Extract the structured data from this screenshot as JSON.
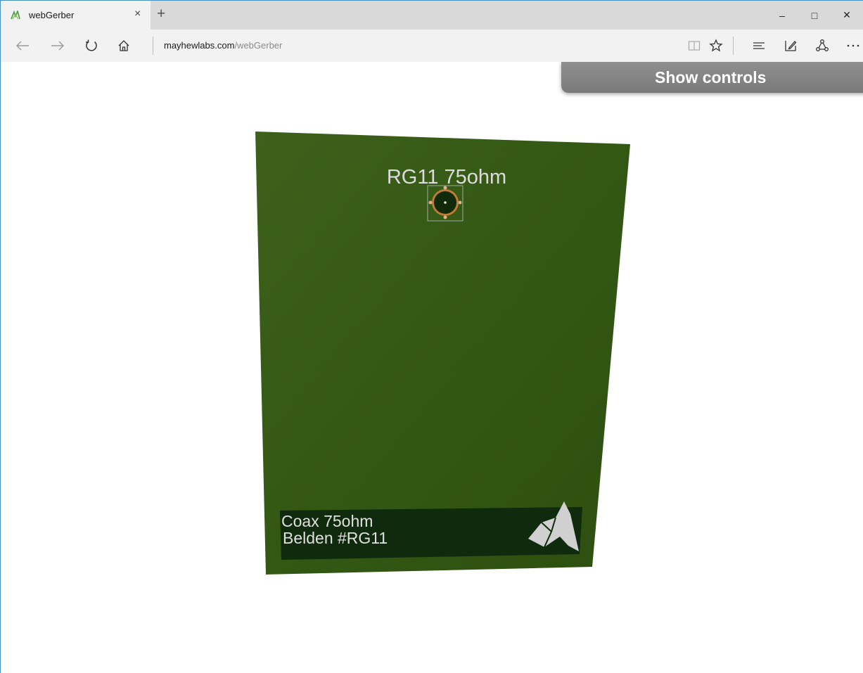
{
  "tab": {
    "title": "webGerber",
    "close_icon": "×",
    "new_tab_icon": "+"
  },
  "window_controls": {
    "minimize": "–",
    "maximize": "□",
    "close": "✕"
  },
  "address": {
    "host": "mayhewlabs.com",
    "path": "/webGerber"
  },
  "page": {
    "show_controls_label": "Show controls",
    "board": {
      "top_label": "RG11 75ohm",
      "bottom_label_line1": "Coax 75ohm",
      "bottom_label_line2": "Belden #RG11",
      "colors": {
        "soldermask": "#355c15",
        "silkscreen": "#d9d9d9",
        "label_box": "#0f2a0c",
        "pad_ring": "#c07a3a"
      }
    }
  }
}
